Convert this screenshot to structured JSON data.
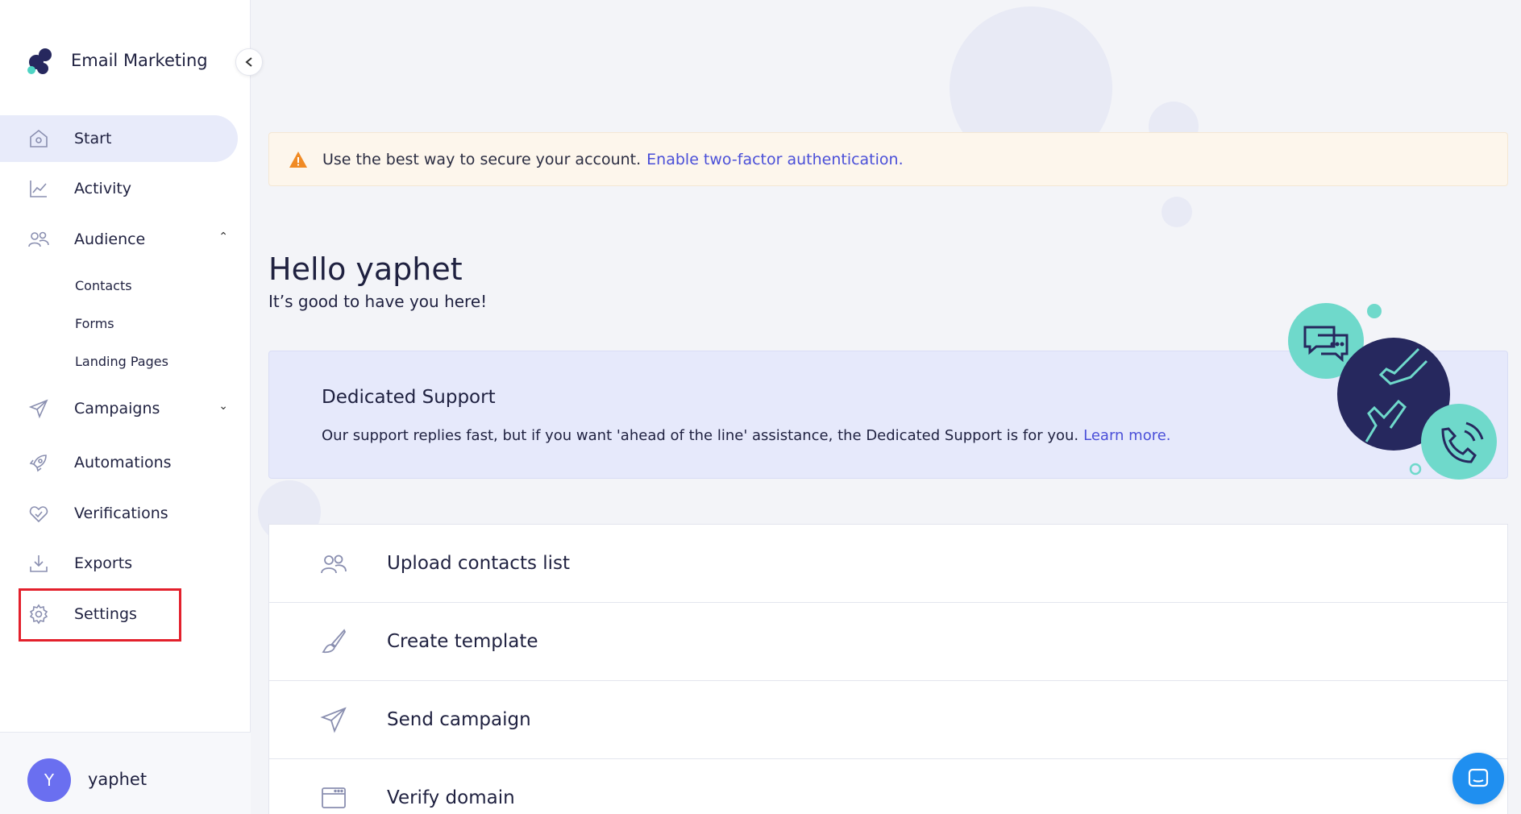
{
  "brand": {
    "title": "Email Marketing"
  },
  "sidebar": {
    "items": [
      {
        "label": "Start",
        "icon": "home-icon"
      },
      {
        "label": "Activity",
        "icon": "chart-icon"
      },
      {
        "label": "Audience",
        "icon": "users-icon"
      },
      {
        "label": "Campaigns",
        "icon": "paper-plane-icon"
      },
      {
        "label": "Automations",
        "icon": "rocket-icon"
      },
      {
        "label": "Verifications",
        "icon": "heart-check-icon"
      },
      {
        "label": "Exports",
        "icon": "download-icon"
      },
      {
        "label": "Settings",
        "icon": "gear-icon"
      }
    ],
    "audience_sub": [
      "Contacts",
      "Forms",
      "Landing Pages"
    ]
  },
  "user": {
    "initial": "Y",
    "name": "yaphet"
  },
  "alert": {
    "text": "Use the best way to secure your account.",
    "link": "Enable two-factor authentication."
  },
  "greeting": {
    "title": "Hello yaphet",
    "subtitle": "It’s good to have you here!"
  },
  "support": {
    "title": "Dedicated Support",
    "text": "Our support replies fast, but if you want 'ahead of the line' assistance, the Dedicated Support is for you.",
    "link": "Learn more."
  },
  "tasks": [
    {
      "label": "Upload contacts list",
      "icon": "users-icon"
    },
    {
      "label": "Create template",
      "icon": "brush-icon"
    },
    {
      "label": "Send campaign",
      "icon": "paper-plane-icon"
    },
    {
      "label": "Verify domain",
      "icon": "browser-icon"
    }
  ],
  "colors": {
    "accent": "#4a4fd8",
    "active_bg": "#e8ebfa",
    "highlight": "#e3202c",
    "teal": "#6fd9cb",
    "navy": "#26285e",
    "chat": "#1f8ff0"
  }
}
